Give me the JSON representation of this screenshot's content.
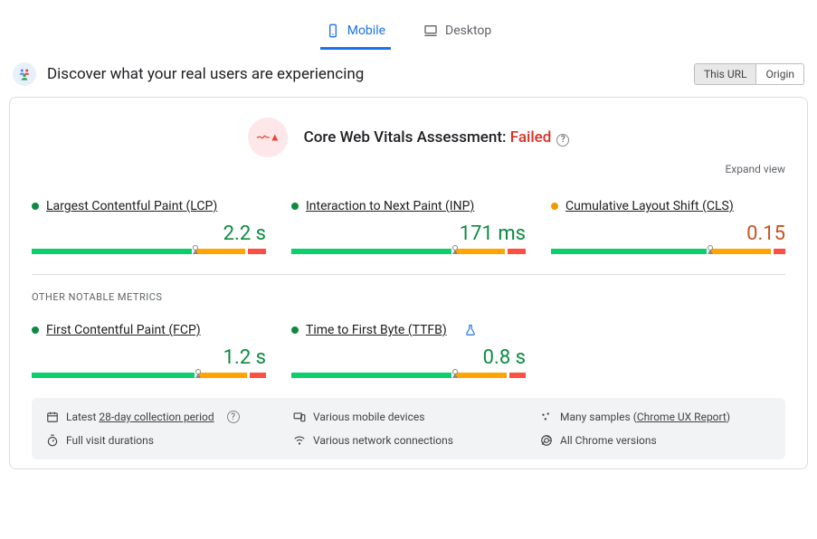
{
  "tabs": {
    "mobile": "Mobile",
    "desktop": "Desktop"
  },
  "header": {
    "title": "Discover what your real users are experiencing"
  },
  "segmented": {
    "this_url": "This URL",
    "origin": "Origin"
  },
  "assessment": {
    "prefix": "Core Web Vitals Assessment: ",
    "status": "Failed"
  },
  "expand": "Expand view",
  "metrics": {
    "lcp": {
      "label": "Largest Contentful Paint (LCP)",
      "value": "2.2 s"
    },
    "inp": {
      "label": "Interaction to Next Paint (INP)",
      "value": "171 ms"
    },
    "cls": {
      "label": "Cumulative Layout Shift (CLS)",
      "value": "0.15"
    },
    "fcp": {
      "label": "First Contentful Paint (FCP)",
      "value": "1.2 s"
    },
    "ttfb": {
      "label": "Time to First Byte (TTFB)",
      "value": "0.8 s"
    }
  },
  "section": "OTHER NOTABLE METRICS",
  "info": {
    "period_prefix": "Latest ",
    "period_link": "28-day collection period",
    "durations": "Full visit durations",
    "devices": "Various mobile devices",
    "network": "Various network connections",
    "samples_prefix": "Many samples (",
    "samples_link": "Chrome UX Report",
    "samples_suffix": ")",
    "versions": "All Chrome versions"
  },
  "chart_data": [
    {
      "type": "bar",
      "metric": "LCP",
      "value": "2.2 s",
      "status": "good",
      "segments": {
        "good": 70,
        "needs_improvement": 22,
        "poor": 8
      },
      "marker_percent": 70
    },
    {
      "type": "bar",
      "metric": "INP",
      "value": "171 ms",
      "status": "good",
      "segments": {
        "good": 70,
        "needs_improvement": 22,
        "poor": 8
      },
      "marker_percent": 70
    },
    {
      "type": "bar",
      "metric": "CLS",
      "value": "0.15",
      "status": "needs_improvement",
      "segments": {
        "good": 68,
        "needs_improvement": 27,
        "poor": 5
      },
      "marker_percent": 68
    },
    {
      "type": "bar",
      "metric": "FCP",
      "value": "1.2 s",
      "status": "good",
      "segments": {
        "good": 71,
        "needs_improvement": 22,
        "poor": 7
      },
      "marker_percent": 71
    },
    {
      "type": "bar",
      "metric": "TTFB",
      "value": "0.8 s",
      "status": "good",
      "segments": {
        "good": 70,
        "needs_improvement": 23,
        "poor": 7
      },
      "marker_percent": 70
    }
  ]
}
